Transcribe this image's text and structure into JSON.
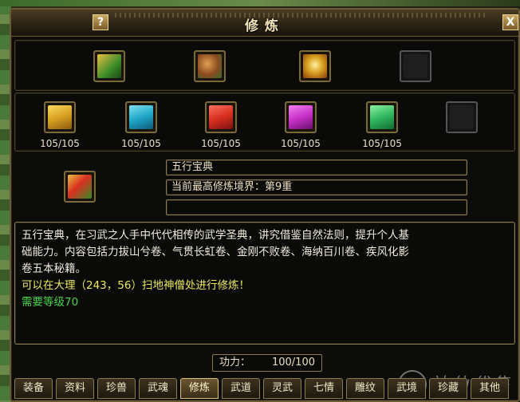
{
  "window": {
    "title": "修炼",
    "help_label": "?",
    "close_label": "X"
  },
  "top_items": [
    {
      "icon": "golden-scroll-book",
      "color": "#3a7a2a"
    },
    {
      "icon": "treasure-drum",
      "color": "#8a4a20"
    },
    {
      "icon": "golden-chest",
      "color": "#c8901a"
    },
    {
      "icon": "empty-slot",
      "color": "#333333"
    }
  ],
  "books": [
    {
      "icon": "yellow-book",
      "color": "#d8a020",
      "count": "105/105"
    },
    {
      "icon": "cyan-book",
      "color": "#20a8c8",
      "count": "105/105"
    },
    {
      "icon": "red-book",
      "color": "#d83020",
      "count": "105/105"
    },
    {
      "icon": "purple-book",
      "color": "#c830c8",
      "count": "105/105"
    },
    {
      "icon": "green-book",
      "color": "#30b860",
      "count": "105/105"
    },
    {
      "icon": "empty-slot",
      "color": "#333333",
      "count": ""
    }
  ],
  "selected": {
    "name": "五行宝典",
    "realm": "当前最高修炼境界：第9重",
    "extra": ""
  },
  "description": {
    "lines": [
      "五行宝典，在习武之人手中代代相传的武学圣典，讲究借鉴自然法则，提升个人基",
      "础能力。内容包括力拔山兮卷、气贯长虹卷、金刚不败卷、海纳百川卷、疾风化影",
      "卷五本秘籍。"
    ],
    "location": "可以在大理（243，56）扫地神僧处进行修炼！",
    "requirement": "需要等级70"
  },
  "power": {
    "label": "功力：",
    "value": "100/100"
  },
  "tabs": [
    "装备",
    "资料",
    "珍兽",
    "武魂",
    "修炼",
    "武道",
    "灵武",
    "七情",
    "雕纹",
    "武境",
    "珍藏",
    "其他"
  ],
  "active_tab": 4,
  "watermark": "神仙代售"
}
